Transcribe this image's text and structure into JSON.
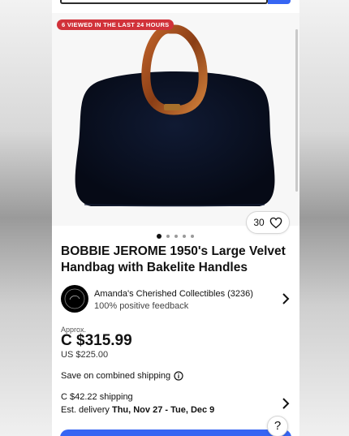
{
  "badge": {
    "viewed_text": "6 VIEWED IN THE LAST 24 HOURS"
  },
  "watch": {
    "count": "30",
    "icon": "heart-outline-icon"
  },
  "carousel": {
    "total": 5,
    "active": 1
  },
  "product": {
    "title": "BOBBIE JEROME 1950's Large Velvet Handbag with Bakelite Handles"
  },
  "seller": {
    "name": "Amanda's Cherished Collectibles (3236)",
    "feedback": "100% positive feedback"
  },
  "pricing": {
    "approx_label": "Approx.",
    "price": "C $315.99",
    "price_us": "US $225.00"
  },
  "shipping": {
    "combined_label": "Save on combined shipping",
    "cost": "C $42.22 shipping",
    "delivery_label": "Est. delivery",
    "delivery_dates": "Thu, Nov 27 - Tue, Dec 9"
  },
  "help": {
    "label": "?"
  },
  "colors": {
    "accent": "#3665f3",
    "badge": "#d1323a"
  }
}
